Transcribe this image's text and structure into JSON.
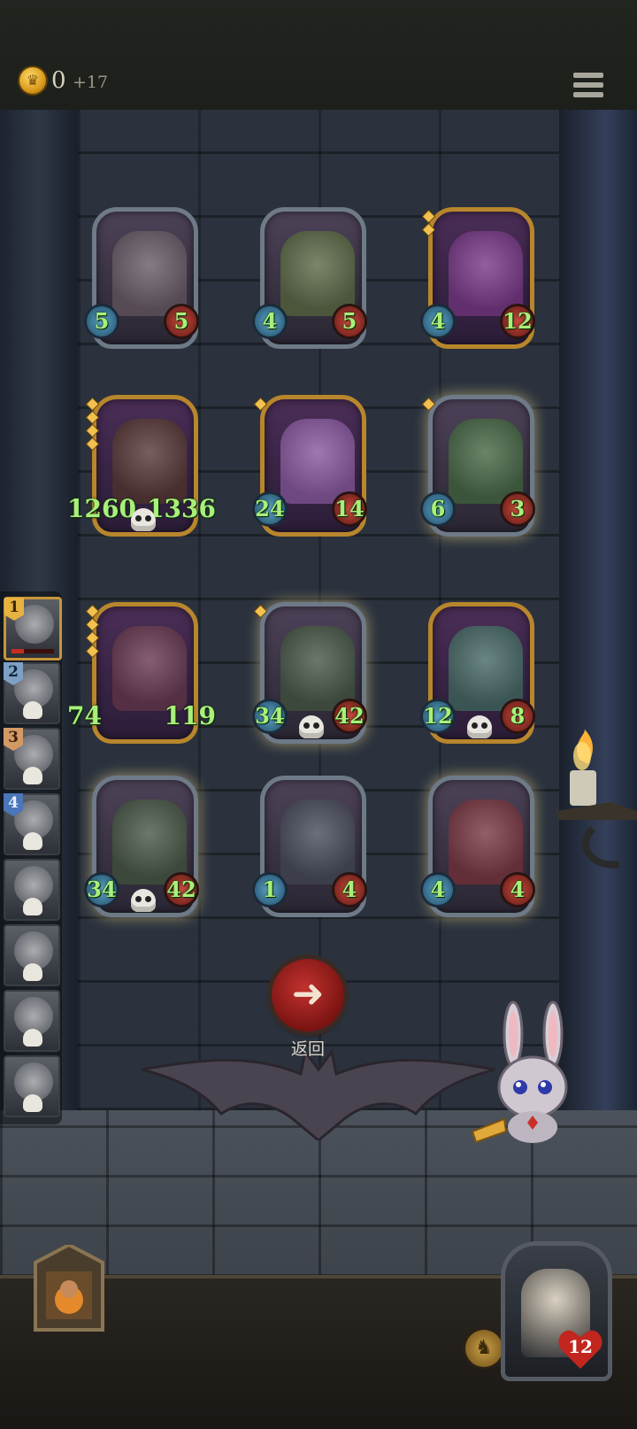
{
  "header": {
    "gold": "0",
    "gold_gain": "+17",
    "coin_icon": "crown-coin-icon",
    "menu_icon": "hamburger-menu-icon"
  },
  "board": {
    "cards": [
      {
        "name": "rabbit-mask-bandit",
        "attack": "5",
        "health": "5",
        "frame": "silver",
        "glow": false,
        "gems": 0,
        "skull": false,
        "art_color": "#6b5e6a"
      },
      {
        "name": "turnip-ghoul",
        "attack": "4",
        "health": "5",
        "frame": "silver",
        "glow": false,
        "gems": 0,
        "skull": false,
        "art_color": "#5f6b4a"
      },
      {
        "name": "elf-sorceress",
        "attack": "4",
        "health": "12",
        "frame": "gold",
        "glow": false,
        "gems": 2,
        "skull": false,
        "art_color": "#7a3b8a"
      },
      {
        "name": "flame-boar",
        "attack": "1260",
        "health": "1336",
        "frame": "gold",
        "glow": false,
        "gems": 4,
        "skull": true,
        "art_color": "#5a3a3a"
      },
      {
        "name": "sleeping-doll",
        "attack": "24",
        "health": "14",
        "frame": "gold",
        "glow": false,
        "gems": 1,
        "skull": false,
        "art_color": "#8a5aa0"
      },
      {
        "name": "green-parrot",
        "attack": "6",
        "health": "3",
        "frame": "silver",
        "glow": true,
        "gems": 1,
        "skull": false,
        "art_color": "#4a6a4a"
      },
      {
        "name": "rocket-wreck",
        "attack": "74",
        "health": "119",
        "frame": "gold",
        "glow": false,
        "gems": 4,
        "skull": false,
        "art_color": "#6a3b55"
      },
      {
        "name": "iron-helm-brute",
        "attack": "34",
        "health": "42",
        "frame": "silver",
        "glow": true,
        "gems": 1,
        "skull": true,
        "art_color": "#4a5a4a"
      },
      {
        "name": "stitched-bunny",
        "attack": "12",
        "health": "8",
        "frame": "gold",
        "glow": false,
        "gems": 0,
        "skull": true,
        "art_color": "#4a6a6a"
      },
      {
        "name": "iron-helm-brute-2",
        "attack": "34",
        "health": "42",
        "frame": "silver",
        "glow": true,
        "gems": 0,
        "skull": true,
        "art_color": "#4a5a4a"
      },
      {
        "name": "grey-rat",
        "attack": "1",
        "health": "4",
        "frame": "silver",
        "glow": false,
        "gems": 0,
        "skull": false,
        "art_color": "#4b4f5e"
      },
      {
        "name": "jester-clown",
        "attack": "4",
        "health": "4",
        "frame": "silver",
        "glow": true,
        "gems": 0,
        "skull": false,
        "art_color": "#7a3a45"
      }
    ]
  },
  "back_button": {
    "label": "返回",
    "icon": "left-arrow-icon"
  },
  "rankings": [
    {
      "rank": "1",
      "badge": "gold",
      "current": true,
      "eliminated": false
    },
    {
      "rank": "2",
      "badge": "blue-light",
      "current": false,
      "eliminated": true
    },
    {
      "rank": "3",
      "badge": "bronze",
      "current": false,
      "eliminated": true
    },
    {
      "rank": "4",
      "badge": "blue",
      "current": false,
      "eliminated": true
    },
    {
      "rank": "",
      "badge": "",
      "current": false,
      "eliminated": true
    },
    {
      "rank": "",
      "badge": "",
      "current": false,
      "eliminated": true
    },
    {
      "rank": "",
      "badge": "",
      "current": false,
      "eliminated": true
    },
    {
      "rank": "",
      "badge": "",
      "current": false,
      "eliminated": true
    }
  ],
  "hero": {
    "health": "12",
    "portrait_icon": "gambler-hero-icon"
  },
  "bottom": {
    "tavern_icon": "tavern-shop-icon",
    "coin_icon": "bell-coin-icon"
  }
}
